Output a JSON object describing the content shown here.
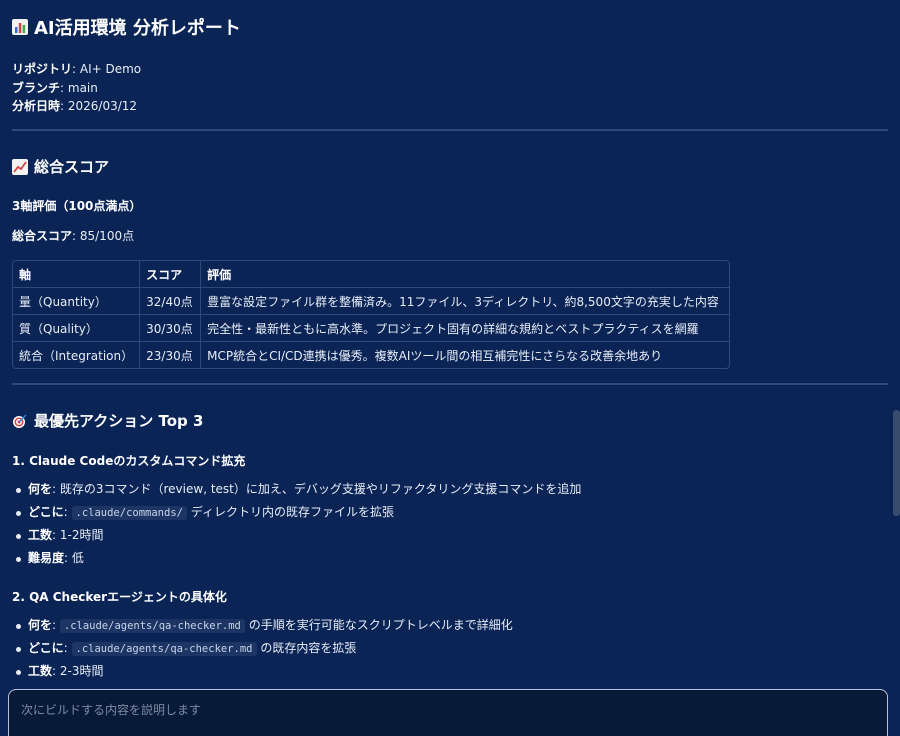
{
  "report": {
    "title": "AI活用環境 分析レポート",
    "repo_label": "リポジトリ",
    "repo_value": ": AI+ Demo",
    "branch_label": "ブランチ",
    "branch_value": ": main",
    "date_label": "分析日時",
    "date_value": ": 2026/03/12"
  },
  "score_section": {
    "heading": "総合スコア",
    "subheading": "3軸評価（100点満点）",
    "total_label": "総合スコア",
    "total_value": ": 85/100点",
    "table": {
      "headers": [
        "軸",
        "スコア",
        "評価"
      ],
      "rows": [
        [
          "量（Quantity）",
          "32/40点",
          "豊富な設定ファイル群を整備済み。11ファイル、3ディレクトリ、約8,500文字の充実した内容"
        ],
        [
          "質（Quality）",
          "30/30点",
          "完全性・最新性ともに高水準。プロジェクト固有の詳細な規約とベストプラクティスを網羅"
        ],
        [
          "統合（Integration）",
          "23/30点",
          "MCP統合とCI/CD連携は優秀。複数AIツール間の相互補完性にさらなる改善余地あり"
        ]
      ]
    }
  },
  "actions_section": {
    "heading": "最優先アクション Top 3",
    "action1": {
      "title": "1. Claude Codeのカスタムコマンド拡充",
      "what_label": "何を",
      "what_text": ": 既存の3コマンド（review, test）に加え、デバッグ支援やリファクタリング支援コマンドを追加",
      "where_label": "どこに",
      "where_sep": ": ",
      "where_code": ".claude/commands/",
      "where_text": " ディレクトリ内の既存ファイルを拡張",
      "effort_label": "工数",
      "effort_text": ": 1-2時間",
      "difficulty_label": "難易度",
      "difficulty_text": ": 低"
    },
    "action2": {
      "title": "2. QA Checkerエージェントの具体化",
      "what_label": "何を",
      "what_sep": ": ",
      "what_code": ".claude/agents/qa-checker.md",
      "what_text": " の手順を実行可能なスクリプトレベルまで詳細化",
      "where_label": "どこに",
      "where_sep": ": ",
      "where_code": ".claude/agents/qa-checker.md",
      "where_text": " の既存内容を拡張",
      "effort_label": "工数",
      "effort_text": ": 2-3時間"
    }
  },
  "input": {
    "placeholder": "次にビルドする内容を説明します"
  },
  "icons": {
    "title_icon": "bar-chart-icon",
    "score_icon": "trend-chart-icon",
    "action_icon": "target-icon"
  }
}
